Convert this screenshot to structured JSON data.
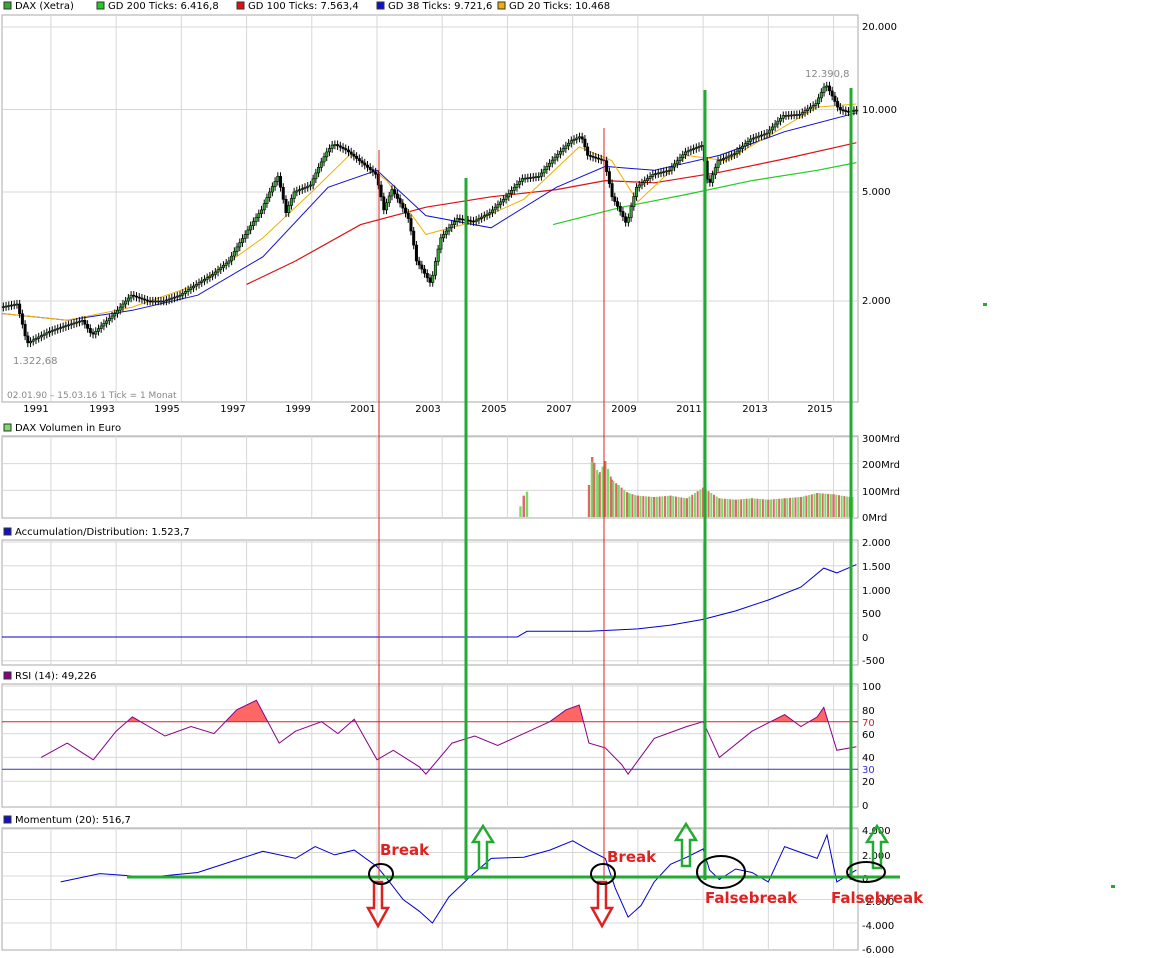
{
  "colors": {
    "grid": "#d7d7d7",
    "candle_up": "#33aa33",
    "candle_down": "#000000",
    "sma200": "#22cc22",
    "sma100": "#dd1111",
    "sma38": "#1111cc",
    "sma20": "#f0b000",
    "vol_up": "#77dd66",
    "vol_down": "#dd6666",
    "rsi_line": "#880088",
    "rsi_fill": "#ff6666",
    "momentum_line": "#0000cc",
    "ad_line": "#0000cc",
    "annot_green": "#22aa33",
    "annot_red": "#dd2222",
    "annot_black": "#000000"
  },
  "price_panel": {
    "legend": [
      {
        "label": "DAX (Xetra)",
        "color": "#33aa33"
      },
      {
        "label": "GD 200 Ticks: 6.416,8",
        "color": "#22cc22"
      },
      {
        "label": "GD 100 Ticks: 7.563,4",
        "color": "#dd1111"
      },
      {
        "label": "GD 38 Ticks: 9.721,6",
        "color": "#1111cc"
      },
      {
        "label": "GD 20 Ticks: 10.468",
        "color": "#f0b000"
      }
    ],
    "y_ticks": [
      "20.000",
      "10.000",
      "5.000",
      "2.000"
    ],
    "x_ticks": [
      "1991",
      "1993",
      "1995",
      "1997",
      "1999",
      "2001",
      "2003",
      "2005",
      "2007",
      "2009",
      "2011",
      "2013",
      "2015"
    ],
    "high_label": "12.390,8",
    "low_label": "1.322,68",
    "info_label": "02.01.90 – 15.03.16   1 Tick = 1 Monat"
  },
  "volume_panel": {
    "title": "DAX Volumen in Euro",
    "y_ticks": [
      "300Mrd",
      "200Mrd",
      "100Mrd",
      "0Mrd"
    ]
  },
  "ad_panel": {
    "title": "Accumulation/Distribution: 1.523,7",
    "y_ticks": [
      "2.000",
      "1.500",
      "1.000",
      "500",
      "0",
      "-500"
    ]
  },
  "rsi_panel": {
    "title": "RSI (14): 49,226",
    "y_ticks": [
      "100",
      "80",
      "60",
      "40",
      "20",
      "0"
    ],
    "level_labels": [
      "70",
      "30"
    ]
  },
  "momentum_panel": {
    "title": "Momentum (20): 516,7",
    "y_ticks": [
      "4.000",
      "2.000",
      "0",
      "-2.000",
      "-4.000",
      "-6.000"
    ]
  },
  "annotations": {
    "break_1": "Break",
    "break_2": "Break",
    "falsebreak_1": "Falsebreak",
    "falsebreak_2": "Falsebreak"
  },
  "chart_data": [
    {
      "type": "line",
      "title": "DAX (Xetra)",
      "x_unit": "year",
      "y_scale": "log",
      "ylim": [
        1200,
        20000
      ],
      "series": [
        {
          "name": "DAX (Xetra)",
          "x": [
            1990.0,
            1990.5,
            1990.8,
            1991.5,
            1992.5,
            1992.8,
            1993.5,
            1994.0,
            1994.5,
            1995.0,
            1995.5,
            1996.0,
            1996.5,
            1997.0,
            1997.5,
            1998.0,
            1998.5,
            1998.75,
            1999.0,
            1999.5,
            2000.0,
            2000.2,
            2000.6,
            2001.0,
            2001.5,
            2001.75,
            2002.0,
            2002.5,
            2002.75,
            2003.2,
            2003.5,
            2004.0,
            2004.5,
            2005.0,
            2005.5,
            2006.0,
            2006.5,
            2007.0,
            2007.5,
            2007.8,
            2008.0,
            2008.5,
            2008.75,
            2009.2,
            2009.5,
            2010.0,
            2010.5,
            2011.0,
            2011.5,
            2011.7,
            2012.0,
            2012.5,
            2013.0,
            2013.5,
            2014.0,
            2014.5,
            2015.0,
            2015.3,
            2015.7,
            2016.0,
            2016.2
          ],
          "values": [
            1900,
            1950,
            1400,
            1550,
            1700,
            1500,
            1800,
            2100,
            2000,
            2000,
            2100,
            2300,
            2500,
            2800,
            3500,
            4300,
            5700,
            4200,
            5000,
            5300,
            7000,
            7500,
            7100,
            6500,
            5800,
            4300,
            5100,
            4000,
            2800,
            2300,
            3400,
            4000,
            3900,
            4200,
            4800,
            5600,
            5700,
            6700,
            7700,
            8000,
            6800,
            6500,
            4800,
            3800,
            5200,
            5800,
            6000,
            7000,
            7400,
            5200,
            6500,
            6900,
            7800,
            8200,
            9500,
            9600,
            10500,
            12390,
            10000,
            9800,
            9950
          ]
        },
        {
          "name": "GD 200 Ticks: 6.416,8",
          "x": [
            2006.9,
            2009.0,
            2011.0,
            2013.0,
            2015.0,
            2016.2
          ],
          "values": [
            3800,
            4400,
            4900,
            5500,
            6000,
            6400
          ]
        },
        {
          "name": "GD 100 Ticks: 7.563,4",
          "x": [
            1997.5,
            1999.0,
            2001.0,
            2003.0,
            2005.0,
            2007.0,
            2008.5,
            2010.0,
            2012.0,
            2014.0,
            2016.2
          ],
          "values": [
            2300,
            2800,
            3800,
            4400,
            4800,
            5100,
            5500,
            5400,
            5900,
            6600,
            7563
          ]
        },
        {
          "name": "GD 38 Ticks: 9.721,6",
          "x": [
            1990.0,
            1992.0,
            1994.0,
            1996.0,
            1998.0,
            2000.0,
            2001.5,
            2003.0,
            2005.0,
            2007.0,
            2008.5,
            2010.0,
            2012.0,
            2014.0,
            2016.2
          ],
          "values": [
            1800,
            1700,
            1850,
            2100,
            2900,
            5200,
            6000,
            4100,
            3700,
            5200,
            6200,
            6000,
            6800,
            8300,
            9721
          ]
        },
        {
          "name": "GD 20 Ticks: 10.468",
          "x": [
            1990.0,
            1992.0,
            1994.0,
            1996.0,
            1998.0,
            1999.5,
            2000.7,
            2001.8,
            2003.0,
            2004.5,
            2006.0,
            2007.7,
            2008.7,
            2009.5,
            2011.0,
            2012.2,
            2013.5,
            2015.0,
            2016.2
          ],
          "values": [
            1800,
            1700,
            1900,
            2300,
            3400,
            5000,
            6900,
            5500,
            3500,
            3900,
            4700,
            7300,
            6500,
            4600,
            6800,
            6500,
            8000,
            10200,
            10468
          ]
        }
      ]
    },
    {
      "type": "bar",
      "title": "DAX Volumen in Euro",
      "x_unit": "year",
      "y_unit": "Mrd",
      "ylim": [
        0,
        300
      ],
      "x": [
        2005.9,
        2006.0,
        2006.1,
        2008.0,
        2008.1,
        2008.3,
        2008.5,
        2008.7,
        2008.9,
        2009.2,
        2009.5,
        2010.0,
        2010.5,
        2011.0,
        2011.5,
        2012.0,
        2012.5,
        2013.0,
        2013.5,
        2014.0,
        2014.5,
        2015.0,
        2015.5,
        2016.0
      ],
      "values": [
        40,
        80,
        95,
        120,
        225,
        160,
        210,
        140,
        120,
        90,
        80,
        75,
        80,
        70,
        110,
        70,
        65,
        70,
        65,
        70,
        75,
        90,
        85,
        75
      ]
    },
    {
      "type": "line",
      "title": "Accumulation/Distribution: 1.523,7",
      "x_unit": "year",
      "ylim": [
        -600,
        2100
      ],
      "series": [
        {
          "name": "Accumulation/Distribution: 1.523,7",
          "x": [
            1990.0,
            2005.8,
            2006.1,
            2008.0,
            2009.5,
            2010.5,
            2011.5,
            2012.5,
            2013.5,
            2014.5,
            2015.2,
            2015.6,
            2016.2
          ],
          "values": [
            0,
            0,
            120,
            120,
            170,
            250,
            370,
            550,
            780,
            1050,
            1450,
            1350,
            1524
          ]
        }
      ]
    },
    {
      "type": "line",
      "title": "RSI (14): 49,226",
      "x_unit": "year",
      "ylim": [
        0,
        100
      ],
      "reference_lines": [
        70,
        30
      ],
      "series": [
        {
          "name": "RSI (14): 49,226",
          "x": [
            1991.2,
            1992.0,
            1992.8,
            1993.5,
            1994.0,
            1995.0,
            1995.8,
            1996.5,
            1997.2,
            1997.8,
            1998.5,
            1999.0,
            1999.8,
            2000.3,
            2000.8,
            2001.5,
            2002.0,
            2002.8,
            2003.0,
            2003.8,
            2004.5,
            2005.2,
            2006.0,
            2006.8,
            2007.3,
            2007.7,
            2008.0,
            2008.5,
            2009.0,
            2009.2,
            2010.0,
            2011.0,
            2011.5,
            2012.0,
            2013.0,
            2014.0,
            2014.5,
            2015.0,
            2015.2,
            2015.6,
            2016.2
          ],
          "values": [
            40,
            52,
            38,
            62,
            74,
            58,
            66,
            60,
            80,
            88,
            52,
            62,
            70,
            60,
            72,
            38,
            46,
            32,
            26,
            52,
            58,
            50,
            60,
            70,
            80,
            84,
            52,
            48,
            34,
            26,
            56,
            66,
            70,
            40,
            62,
            76,
            66,
            74,
            82,
            46,
            49
          ]
        }
      ]
    },
    {
      "type": "line",
      "title": "Momentum (20): 516,7",
      "x_unit": "year",
      "ylim": [
        -6000,
        4500
      ],
      "series": [
        {
          "name": "Momentum (20): 516,7",
          "x": [
            1991.8,
            1993.0,
            1994.5,
            1996.0,
            1997.0,
            1998.0,
            1999.0,
            1999.6,
            2000.2,
            2000.8,
            2001.5,
            2001.8,
            2002.3,
            2002.8,
            2003.2,
            2003.7,
            2004.3,
            2005.0,
            2006.0,
            2006.8,
            2007.5,
            2008.0,
            2008.5,
            2008.8,
            2009.2,
            2009.6,
            2010.0,
            2010.5,
            2011.0,
            2011.5,
            2011.7,
            2012.0,
            2012.5,
            2013.0,
            2013.5,
            2014.0,
            2014.5,
            2015.0,
            2015.3,
            2015.6,
            2016.2
          ],
          "values": [
            -500,
            200,
            -100,
            300,
            1200,
            2100,
            1500,
            2500,
            1800,
            2200,
            800,
            -200,
            -2000,
            -3000,
            -4000,
            -1800,
            -200,
            1500,
            1600,
            2200,
            3000,
            2200,
            1500,
            -1000,
            -3500,
            -2500,
            -500,
            1000,
            1600,
            2300,
            500,
            -300,
            600,
            300,
            -500,
            2500,
            2000,
            1500,
            3500,
            -500,
            517
          ]
        }
      ]
    }
  ]
}
